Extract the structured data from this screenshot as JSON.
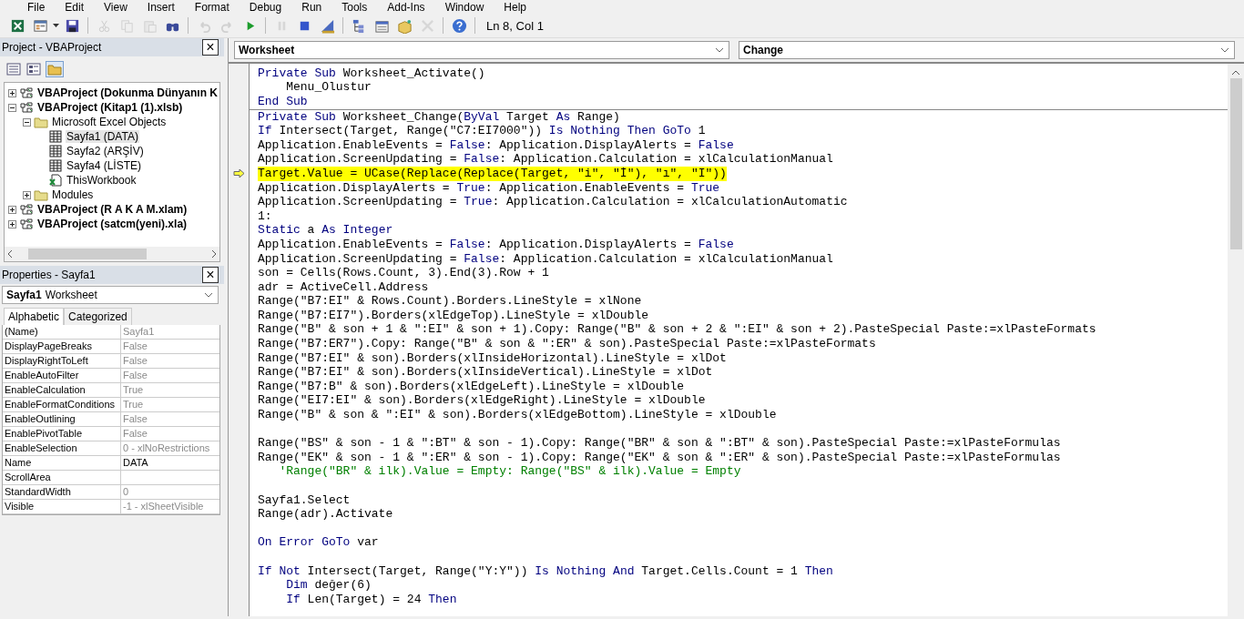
{
  "menu": [
    "File",
    "Edit",
    "View",
    "Insert",
    "Format",
    "Debug",
    "Run",
    "Tools",
    "Add-Ins",
    "Window",
    "Help"
  ],
  "toolbar": {
    "buttons": [
      {
        "disabled": false
      },
      {
        "disabled": false
      },
      {
        "disabled": false
      },
      {
        "disabled": true
      },
      {
        "disabled": true
      },
      {
        "disabled": true
      },
      {
        "disabled": false
      },
      {
        "disabled": true
      },
      {
        "disabled": true
      },
      {
        "disabled": false
      },
      {
        "disabled": true
      },
      {
        "disabled": false
      },
      {
        "disabled": false
      },
      {
        "disabled": false
      },
      {
        "disabled": false
      },
      {
        "disabled": false
      },
      {
        "disabled": true
      },
      {
        "disabled": false
      }
    ],
    "position": "Ln 8, Col 1"
  },
  "project": {
    "title": "Project - VBAProject",
    "close": "×",
    "tree": [
      {
        "kind": "project",
        "label": "VBAProject (Dokunma Dünyanın K",
        "expanded": false
      },
      {
        "kind": "project",
        "label": "VBAProject (Kitap1 (1).xlsb)",
        "expanded": true,
        "children": [
          {
            "kind": "folder",
            "label": "Microsoft Excel Objects",
            "expanded": true,
            "children": [
              {
                "kind": "sheet",
                "label": "Sayfa1 (DATA)",
                "selected": true
              },
              {
                "kind": "sheet",
                "label": "Sayfa2 (ARŞİV)",
                "selected": false
              },
              {
                "kind": "sheet",
                "label": "Sayfa4 (LİSTE)",
                "selected": false
              },
              {
                "kind": "workbook",
                "label": "ThisWorkbook",
                "selected": false
              }
            ]
          },
          {
            "kind": "folder",
            "label": "Modules",
            "expanded": false
          }
        ]
      },
      {
        "kind": "project",
        "label": "VBAProject (R A K A M.xlam)",
        "expanded": false
      },
      {
        "kind": "project",
        "label": "VBAProject (satcm(yeni).xla)",
        "expanded": false
      }
    ]
  },
  "properties": {
    "title": "Properties - Sayfa1",
    "close": "×",
    "object_name": "Sayfa1",
    "object_type": "Worksheet",
    "tabs": [
      {
        "label": "Alphabetic",
        "selected": true
      },
      {
        "label": "Categorized",
        "selected": false
      }
    ],
    "rows": [
      {
        "name": "(Name)",
        "value": "Sayfa1",
        "disabled": true
      },
      {
        "name": "DisplayPageBreaks",
        "value": "False",
        "disabled": true
      },
      {
        "name": "DisplayRightToLeft",
        "value": "False",
        "disabled": true
      },
      {
        "name": "EnableAutoFilter",
        "value": "False",
        "disabled": true
      },
      {
        "name": "EnableCalculation",
        "value": "True",
        "disabled": true
      },
      {
        "name": "EnableFormatConditions",
        "value": "True",
        "disabled": true
      },
      {
        "name": "EnableOutlining",
        "value": "False",
        "disabled": true
      },
      {
        "name": "EnablePivotTable",
        "value": "False",
        "disabled": true
      },
      {
        "name": "EnableSelection",
        "value": "0 - xlNoRestrictions",
        "disabled": true
      },
      {
        "name": "Name",
        "value": "DATA",
        "disabled": false
      },
      {
        "name": "ScrollArea"
      },
      {
        "name": "StandardWidth",
        "value": "0",
        "disabled": true
      },
      {
        "name": "Visible",
        "value": "-1 - xlSheetVisible",
        "disabled": true
      }
    ]
  },
  "code": {
    "object": "Worksheet",
    "procedure": "Change",
    "procedures": [
      {
        "lines": [
          {
            "current": false,
            "parts": [
              {
                "kind": "keyword",
                "text": "Private Sub"
              },
              {
                "kind": "plain",
                "text": " Worksheet_Activate()"
              }
            ]
          },
          {
            "current": false,
            "parts": [
              {
                "kind": "plain",
                "text": "    Menu_Olustur"
              }
            ]
          },
          {
            "current": false,
            "parts": [
              {
                "kind": "keyword",
                "text": "End Sub"
              }
            ]
          }
        ]
      },
      {
        "lines": [
          {
            "current": false,
            "parts": [
              {
                "kind": "keyword",
                "text": "Private Sub"
              },
              {
                "kind": "plain",
                "text": " Worksheet_Change("
              },
              {
                "kind": "keyword",
                "text": "ByVal"
              },
              {
                "kind": "plain",
                "text": " Target "
              },
              {
                "kind": "keyword",
                "text": "As"
              },
              {
                "kind": "plain",
                "text": " Range)"
              }
            ]
          },
          {
            "current": false,
            "parts": [
              {
                "kind": "keyword",
                "text": "If"
              },
              {
                "kind": "plain",
                "text": " Intersect(Target, Range(\"C7:EI7000\")) "
              },
              {
                "kind": "keyword",
                "text": "Is Nothing Then GoTo"
              },
              {
                "kind": "plain",
                "text": " 1"
              }
            ]
          },
          {
            "current": false,
            "parts": [
              {
                "kind": "plain",
                "text": "Application.EnableEvents = "
              },
              {
                "kind": "keyword",
                "text": "False"
              },
              {
                "kind": "plain",
                "text": ": Application.DisplayAlerts = "
              },
              {
                "kind": "keyword",
                "text": "False"
              }
            ]
          },
          {
            "current": false,
            "parts": [
              {
                "kind": "plain",
                "text": "Application.ScreenUpdating = "
              },
              {
                "kind": "keyword",
                "text": "False"
              },
              {
                "kind": "plain",
                "text": ": Application.Calculation = xlCalculationManual"
              }
            ]
          },
          {
            "current": true,
            "parts": [
              {
                "kind": "plain",
                "text": "Target.Value = UCase(Replace(Replace(Target, \"i\", \"İ\"), \"ı\", \"I\"))"
              }
            ]
          },
          {
            "current": false,
            "parts": [
              {
                "kind": "plain",
                "text": "Application.DisplayAlerts = "
              },
              {
                "kind": "keyword",
                "text": "True"
              },
              {
                "kind": "plain",
                "text": ": Application.EnableEvents = "
              },
              {
                "kind": "keyword",
                "text": "True"
              }
            ]
          },
          {
            "current": false,
            "parts": [
              {
                "kind": "plain",
                "text": "Application.ScreenUpdating = "
              },
              {
                "kind": "keyword",
                "text": "True"
              },
              {
                "kind": "plain",
                "text": ": Application.Calculation = xlCalculationAutomatic"
              }
            ]
          },
          {
            "current": false,
            "parts": [
              {
                "kind": "plain",
                "text": "1:"
              }
            ]
          },
          {
            "current": false,
            "parts": [
              {
                "kind": "keyword",
                "text": "Static"
              },
              {
                "kind": "plain",
                "text": " a "
              },
              {
                "kind": "keyword",
                "text": "As Integer"
              }
            ]
          },
          {
            "current": false,
            "parts": [
              {
                "kind": "plain",
                "text": "Application.EnableEvents = "
              },
              {
                "kind": "keyword",
                "text": "False"
              },
              {
                "kind": "plain",
                "text": ": Application.DisplayAlerts = "
              },
              {
                "kind": "keyword",
                "text": "False"
              }
            ]
          },
          {
            "current": false,
            "parts": [
              {
                "kind": "plain",
                "text": "Application.ScreenUpdating = "
              },
              {
                "kind": "keyword",
                "text": "False"
              },
              {
                "kind": "plain",
                "text": ": Application.Calculation = xlCalculationManual"
              }
            ]
          },
          {
            "current": false,
            "parts": [
              {
                "kind": "plain",
                "text": "son = Cells(Rows.Count, 3).End(3).Row + 1"
              }
            ]
          },
          {
            "current": false,
            "parts": [
              {
                "kind": "plain",
                "text": "adr = ActiveCell.Address"
              }
            ]
          },
          {
            "current": false,
            "parts": [
              {
                "kind": "plain",
                "text": "Range(\"B7:EI\" & Rows.Count).Borders.LineStyle = xlNone"
              }
            ]
          },
          {
            "current": false,
            "parts": [
              {
                "kind": "plain",
                "text": "Range(\"B7:EI7\").Borders(xlEdgeTop).LineStyle = xlDouble"
              }
            ]
          },
          {
            "current": false,
            "parts": [
              {
                "kind": "plain",
                "text": "Range(\"B\" & son + 1 & \":EI\" & son + 1).Copy: Range(\"B\" & son + 2 & \":EI\" & son + 2).PasteSpecial Paste:=xlPasteFormats"
              }
            ]
          },
          {
            "current": false,
            "parts": [
              {
                "kind": "plain",
                "text": "Range(\"B7:ER7\").Copy: Range(\"B\" & son & \":ER\" & son).PasteSpecial Paste:=xlPasteFormats"
              }
            ]
          },
          {
            "current": false,
            "parts": [
              {
                "kind": "plain",
                "text": "Range(\"B7:EI\" & son).Borders(xlInsideHorizontal).LineStyle = xlDot"
              }
            ]
          },
          {
            "current": false,
            "parts": [
              {
                "kind": "plain",
                "text": "Range(\"B7:EI\" & son).Borders(xlInsideVertical).LineStyle = xlDot"
              }
            ]
          },
          {
            "current": false,
            "parts": [
              {
                "kind": "plain",
                "text": "Range(\"B7:B\" & son).Borders(xlEdgeLeft).LineStyle = xlDouble"
              }
            ]
          },
          {
            "current": false,
            "parts": [
              {
                "kind": "plain",
                "text": "Range(\"EI7:EI\" & son).Borders(xlEdgeRight).LineStyle = xlDouble"
              }
            ]
          },
          {
            "current": false,
            "parts": [
              {
                "kind": "plain",
                "text": "Range(\"B\" & son & \":EI\" & son).Borders(xlEdgeBottom).LineStyle = xlDouble"
              }
            ]
          },
          {
            "kind": "blank"
          },
          {
            "current": false,
            "parts": [
              {
                "kind": "plain",
                "text": "Range(\"BS\" & son - 1 & \":BT\" & son - 1).Copy: Range(\"BR\" & son & \":BT\" & son).PasteSpecial Paste:=xlPasteFormulas"
              }
            ]
          },
          {
            "current": false,
            "parts": [
              {
                "kind": "plain",
                "text": "Range(\"EK\" & son - 1 & \":ER\" & son - 1).Copy: Range(\"EK\" & son & \":ER\" & son).PasteSpecial Paste:=xlPasteFormulas"
              }
            ]
          },
          {
            "current": false,
            "parts": [
              {
                "kind": "comment",
                "text": "   'Range(\"BR\" & ilk).Value = Empty: Range(\"BS\" & ilk).Value = Empty"
              }
            ]
          },
          {
            "kind": "blank"
          },
          {
            "current": false,
            "parts": [
              {
                "kind": "plain",
                "text": "Sayfa1.Select"
              }
            ]
          },
          {
            "current": false,
            "parts": [
              {
                "kind": "plain",
                "text": "Range(adr).Activate"
              }
            ]
          },
          {
            "kind": "blank"
          },
          {
            "current": false,
            "parts": [
              {
                "kind": "keyword",
                "text": "On Error GoTo"
              },
              {
                "kind": "plain",
                "text": " var"
              }
            ]
          },
          {
            "kind": "blank"
          },
          {
            "current": false,
            "parts": [
              {
                "kind": "keyword",
                "text": "If Not"
              },
              {
                "kind": "plain",
                "text": " Intersect(Target, Range(\"Y:Y\")) "
              },
              {
                "kind": "keyword",
                "text": "Is Nothing And"
              },
              {
                "kind": "plain",
                "text": " Target.Cells.Count = 1 "
              },
              {
                "kind": "keyword",
                "text": "Then"
              }
            ]
          },
          {
            "current": false,
            "parts": [
              {
                "kind": "keyword",
                "text": "    Dim"
              },
              {
                "kind": "plain",
                "text": " değer(6)"
              }
            ]
          },
          {
            "current": false,
            "parts": [
              {
                "kind": "keyword",
                "text": "    If"
              },
              {
                "kind": "plain",
                "text": " Len(Target) = 24 "
              },
              {
                "kind": "keyword",
                "text": "Then"
              }
            ]
          }
        ]
      }
    ]
  }
}
